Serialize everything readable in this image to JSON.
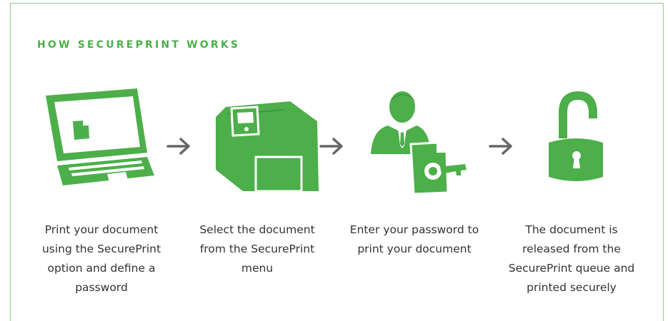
{
  "title": "HOW SECUREPRINT WORKS",
  "accent_color": "#4caf4a",
  "arrow_color": "#666666",
  "steps": [
    {
      "icon": "laptop-document-icon",
      "caption": "Print your document using the SecurePrint option and define a password"
    },
    {
      "icon": "printer-select-icon",
      "caption": "Select the document from the SecurePrint menu"
    },
    {
      "icon": "user-password-key-icon",
      "caption": "Enter your password to print your document"
    },
    {
      "icon": "unlocked-padlock-icon",
      "caption": "The document is released from the SecurePrint queue and printed securely"
    }
  ]
}
